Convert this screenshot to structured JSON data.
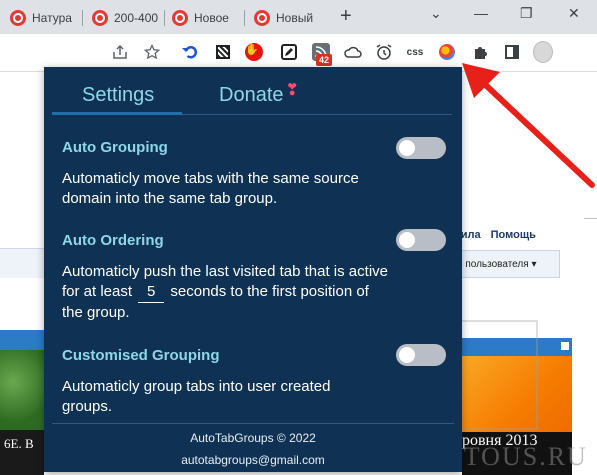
{
  "tabs": [
    {
      "label": "Натура"
    },
    {
      "label": "200-400"
    },
    {
      "label": "Новое"
    },
    {
      "label": "Новый"
    }
  ],
  "new_tab_symbol": "+",
  "window_controls": {
    "chevron": "⌄",
    "minimize": "—",
    "restore": "❐",
    "close": "✕"
  },
  "toolbar": {
    "rss_badge": "42",
    "css_icon": "css",
    "icons": [
      "share-icon",
      "star-icon",
      "undo-close-tab-icon",
      "qr-code-icon",
      "hand-stop-icon",
      "pen-edit-icon",
      "rss-icon",
      "cloud-icon",
      "alarm-clock-icon",
      "css-icon",
      "autotabgroups-icon",
      "extensions-puzzle-icon",
      "side-panel-icon",
      "profile-avatar"
    ]
  },
  "page_behind": {
    "nav_items": [
      "вила",
      "Помощь"
    ],
    "select_text": "о пользователя",
    "left_banner": "6Е. В",
    "right_banner": "ровня 2013",
    "watermark": "WEBTOUS.RU"
  },
  "popup": {
    "tab_settings": "Settings",
    "tab_donate": "Donate",
    "sections": [
      {
        "title": "Auto Grouping",
        "description": "Automaticly move tabs with the same source domain into the same tab group.",
        "enabled": false
      },
      {
        "title": "Auto Ordering",
        "description_before": "Automaticly push the last visited tab that is active for at least",
        "seconds_value": "5",
        "description_after": "seconds to the first position of the group.",
        "enabled": false
      },
      {
        "title": "Customised Grouping",
        "description": "Automaticly group tabs into user created groups.",
        "enabled": false
      }
    ],
    "footer_copyright": "AutoTabGroups © 2022",
    "footer_email": "autotabgroups@gmail.com"
  },
  "colors": {
    "popup_bg": "#0f3254",
    "accent": "#8fd6e8",
    "toggle_off": "#b9bec6",
    "arrow": "#e8201a"
  }
}
